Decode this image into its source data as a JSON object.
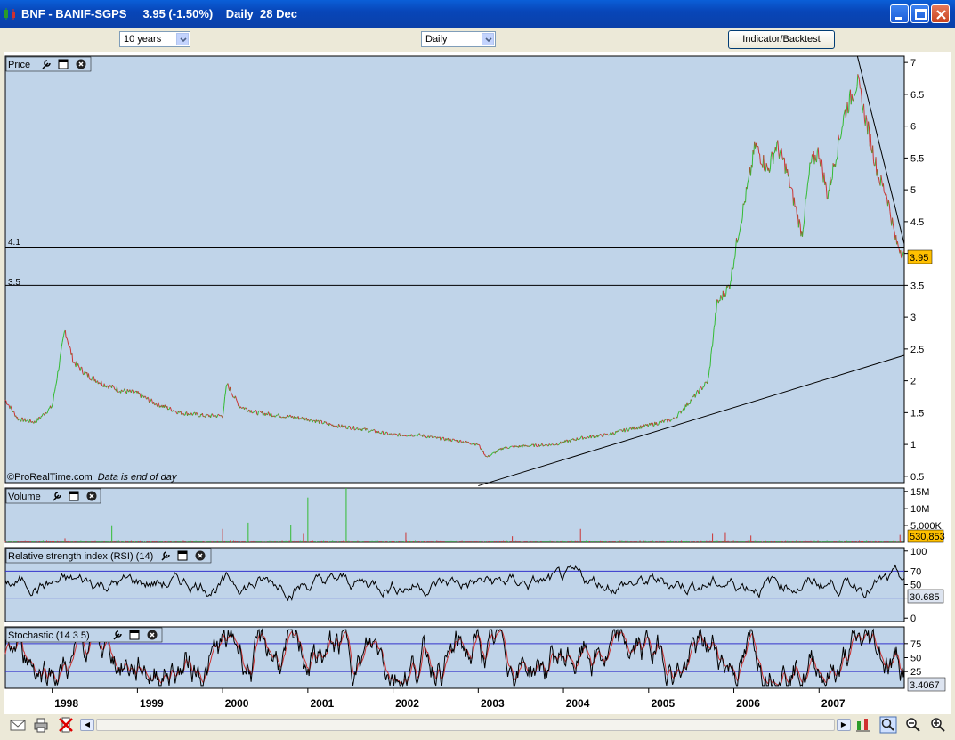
{
  "window": {
    "title": "BNF - BANIF-SGPS     3.95 (-1.50%)    Daily  28 Dec",
    "controls": [
      "minimize",
      "maximize",
      "close"
    ]
  },
  "toolbar": {
    "period_select": "10 years",
    "interval_select": "Daily",
    "indicator_button": "Indicator/Backtest"
  },
  "panels": {
    "price": {
      "title": "Price",
      "credit": "©ProRealTime.com",
      "note": "Data is end of day",
      "hline_labels": [
        "4.1",
        "3.5"
      ],
      "current_value": "3.95"
    },
    "volume": {
      "title": "Volume",
      "current_value": "530,853"
    },
    "rsi": {
      "title": "Relative strength index (RSI) (14)",
      "current_value": "30.685"
    },
    "stochastic": {
      "title": "Stochastic (14 3 5)",
      "current_value": "3.4067"
    }
  },
  "colors": {
    "panel_bg": "#c0d4e9",
    "up": "#33bb33",
    "down": "#cc3333",
    "value_box": "#ffc000",
    "band_line": "#3333cc"
  },
  "chart_data": [
    {
      "type": "line",
      "panel": "price",
      "ylim": [
        0.4,
        7.1
      ],
      "y_ticks": [
        {
          "v": 7,
          "label": "7"
        },
        {
          "v": 6.5,
          "label": "6.5"
        },
        {
          "v": 6,
          "label": "6"
        },
        {
          "v": 5.5,
          "label": "5.5"
        },
        {
          "v": 5,
          "label": "5"
        },
        {
          "v": 4.5,
          "label": "4.5"
        },
        {
          "v": 4,
          "label": "4"
        },
        {
          "v": 3.5,
          "label": "3.5"
        },
        {
          "v": 3,
          "label": "3"
        },
        {
          "v": 2.5,
          "label": "2.5"
        },
        {
          "v": 2,
          "label": "2"
        },
        {
          "v": 1.5,
          "label": "1.5"
        },
        {
          "v": 1,
          "label": "1"
        },
        {
          "v": 0.5,
          "label": "0.5"
        }
      ],
      "x_ticks": [
        {
          "t": 1998.0,
          "label": "1998"
        },
        {
          "t": 1999.0,
          "label": "1999"
        },
        {
          "t": 2000.0,
          "label": "2000"
        },
        {
          "t": 2001.0,
          "label": "2001"
        },
        {
          "t": 2002.0,
          "label": "2002"
        },
        {
          "t": 2003.0,
          "label": "2003"
        },
        {
          "t": 2004.0,
          "label": "2004"
        },
        {
          "t": 2005.0,
          "label": "2005"
        },
        {
          "t": 2006.0,
          "label": "2006"
        },
        {
          "t": 2007.0,
          "label": "2007"
        }
      ],
      "x_range": [
        1997.45,
        2008.0
      ],
      "x": [
        1997.45,
        1997.6,
        1997.8,
        1998.0,
        1998.15,
        1998.25,
        1998.4,
        1998.6,
        1998.8,
        1999.0,
        1999.2,
        1999.5,
        1999.8,
        2000.0,
        2000.05,
        2000.2,
        2000.4,
        2000.7,
        2001.0,
        2001.3,
        2001.6,
        2001.8,
        2002.0,
        2002.3,
        2002.5,
        2002.8,
        2003.0,
        2003.1,
        2003.3,
        2003.6,
        2003.9,
        2004.2,
        2004.5,
        2004.8,
        2005.0,
        2005.3,
        2005.5,
        2005.7,
        2005.8,
        2005.95,
        2006.05,
        2006.2,
        2006.25,
        2006.4,
        2006.5,
        2006.6,
        2006.8,
        2006.9,
        2007.0,
        2007.1,
        2007.3,
        2007.45,
        2007.6,
        2007.7,
        2007.8,
        2007.9,
        2008.0
      ],
      "values": [
        1.7,
        1.4,
        1.35,
        1.6,
        2.8,
        2.3,
        2.1,
        1.95,
        1.85,
        1.8,
        1.65,
        1.5,
        1.45,
        1.45,
        1.95,
        1.6,
        1.5,
        1.45,
        1.4,
        1.3,
        1.25,
        1.2,
        1.15,
        1.15,
        1.1,
        1.05,
        1.0,
        0.8,
        0.95,
        0.98,
        1.0,
        1.1,
        1.15,
        1.25,
        1.3,
        1.4,
        1.7,
        2.0,
        3.2,
        3.5,
        4.3,
        5.3,
        5.7,
        5.3,
        5.7,
        5.4,
        4.3,
        5.4,
        5.6,
        4.9,
        6.2,
        6.7,
        5.8,
        5.2,
        4.9,
        4.2,
        3.95
      ],
      "hlines": [
        4.1,
        3.5
      ],
      "trendlines": [
        {
          "from": [
            2003.0,
            0.35
          ],
          "to": [
            2008.0,
            2.4
          ]
        },
        {
          "from": [
            2007.45,
            7.1
          ],
          "to": [
            2008.0,
            4.15
          ]
        }
      ]
    },
    {
      "type": "bar",
      "panel": "volume",
      "ylim": [
        0,
        16
      ],
      "y_ticks": [
        {
          "v": 15,
          "label": "15M"
        },
        {
          "v": 10,
          "label": "10M"
        },
        {
          "v": 5,
          "label": "5,000K"
        }
      ],
      "spikes": [
        {
          "t": 1998.15,
          "v": 1.2
        },
        {
          "t": 1998.7,
          "v": 4.8
        },
        {
          "t": 2000.0,
          "v": 4.0
        },
        {
          "t": 2000.3,
          "v": 5.8
        },
        {
          "t": 2000.8,
          "v": 5.0
        },
        {
          "t": 2000.95,
          "v": 2.5
        },
        {
          "t": 2001.0,
          "v": 13.2
        },
        {
          "t": 2001.45,
          "v": 17.0
        },
        {
          "t": 2002.15,
          "v": 3.0
        },
        {
          "t": 2003.4,
          "v": 1.8
        },
        {
          "t": 2004.2,
          "v": 4.0
        },
        {
          "t": 2005.75,
          "v": 2.5
        },
        {
          "t": 2005.9,
          "v": 3.0
        },
        {
          "t": 2006.2,
          "v": 2.0
        },
        {
          "t": 2007.95,
          "v": 2.2
        }
      ]
    },
    {
      "type": "line",
      "panel": "rsi",
      "ylim": [
        -5,
        105
      ],
      "y_ticks": [
        {
          "v": 100,
          "label": "100"
        },
        {
          "v": 70,
          "label": "70"
        },
        {
          "v": 50,
          "label": "50"
        },
        {
          "v": 30,
          "label": "30"
        },
        {
          "v": 0,
          "label": "0"
        }
      ],
      "bands": [
        70,
        30
      ]
    },
    {
      "type": "line",
      "panel": "stochastic",
      "ylim": [
        -5,
        105
      ],
      "y_ticks": [
        {
          "v": 75,
          "label": "75"
        },
        {
          "v": 50,
          "label": "50"
        },
        {
          "v": 25,
          "label": "25"
        }
      ],
      "bands": [
        75,
        25
      ]
    }
  ]
}
